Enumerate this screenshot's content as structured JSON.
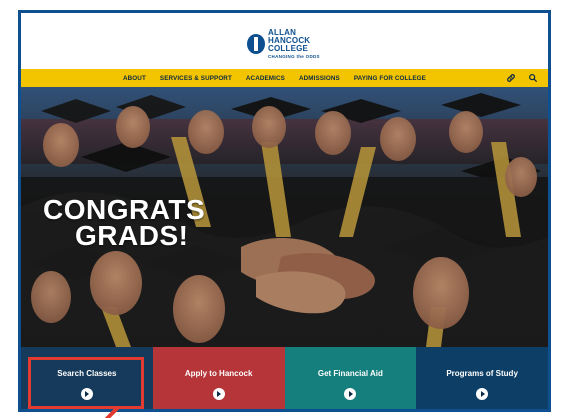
{
  "header": {
    "logo": {
      "line1": "ALLAN",
      "line2": "HANCOCK",
      "line3": "COLLEGE",
      "tagline": "CHANGING the ODDS"
    }
  },
  "nav": {
    "items": [
      {
        "label": "ABOUT"
      },
      {
        "label": "SERVICES & SUPPORT"
      },
      {
        "label": "ACADEMICS"
      },
      {
        "label": "ADMISSIONS"
      },
      {
        "label": "PAYING FOR COLLEGE"
      }
    ],
    "icons": [
      "link-icon",
      "search-icon"
    ]
  },
  "hero": {
    "headline_line1": "CONGRATS",
    "headline_line2": "GRADS!"
  },
  "ctas": [
    {
      "label": "Search Classes"
    },
    {
      "label": "Apply to Hancock"
    },
    {
      "label": "Get Financial Aid"
    },
    {
      "label": "Programs of Study"
    }
  ],
  "colors": {
    "brand_blue": "#0d4f8f",
    "nav_yellow": "#f2c500",
    "cta_search": "#163a5b",
    "cta_apply": "#b63538",
    "cta_aid": "#147f7c",
    "cta_study": "#0d3e66",
    "highlight": "#e23b2f"
  }
}
